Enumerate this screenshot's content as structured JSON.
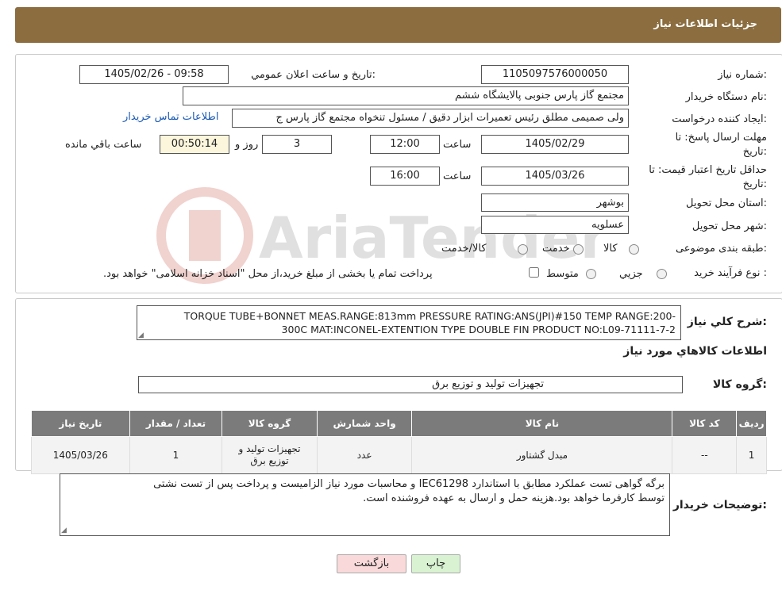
{
  "header": {
    "title": "جزئیات اطلاعات نیاز"
  },
  "form": {
    "need_number": {
      "label": "شماره نیاز:",
      "value": "1105097576000050"
    },
    "announce_datetime": {
      "label": "تاريخ و ساعت اعلان عمومي:",
      "value": "1405/02/26 - 09:58"
    },
    "buyer_org": {
      "label": "نام دستگاه خريدار:",
      "value": "مجتمع گاز پارس جنوبی  پالایشگاه ششم"
    },
    "requester": {
      "label": "ايجاد کننده درخواست:",
      "value": "ولی صمیمی مطلق رئیس تعمیرات ابزار دقیق / مسئول تنخواه مجتمع گاز پارس ج",
      "contact_link": "اطلاعات تماس خريدار"
    },
    "reply_deadline": {
      "label_line1": "مهلت ارسال پاسخ: تا",
      "label_line2": "تاريخ:",
      "date": "1405/02/29",
      "time_label": "ساعت",
      "time": "12:00",
      "days": "3",
      "days_label": "روز و",
      "remaining": "00:50:14",
      "remaining_label": "ساعت باقي مانده"
    },
    "price_validity": {
      "label_line1": "حداقل تاريخ اعتبار قيمت: تا",
      "label_line2": "تاريخ:",
      "date": "1405/03/26",
      "time_label": "ساعت",
      "time": "16:00"
    },
    "province": {
      "label": "استان محل تحويل:",
      "value": "بوشهر"
    },
    "city": {
      "label": "شهر محل تحويل:",
      "value": "عسلویه"
    },
    "category": {
      "label": "طبقه بندی موضوعی:",
      "options": [
        "کالا",
        "خدمت",
        "کالا/خدمت"
      ]
    },
    "purchase_process": {
      "label": "نوع فرآيند خريد :",
      "options": [
        "جزيي",
        "متوسط"
      ],
      "note": "پرداخت تمام يا بخشی از مبلغ خريد،از محل \"اسناد خزانه اسلامی\" خواهد بود."
    }
  },
  "description": {
    "label": "شرح کلي نياز:",
    "line1": "TORQUE TUBE+BONNET MEAS.RANGE:813mm PRESSURE RATING:ANS(JPI)#150 TEMP RANGE:200-",
    "line2": "300C MAT:INCONEL-EXTENTION TYPE DOUBLE FIN PRODUCT NO:L09-71111-7-2"
  },
  "goods_section": {
    "title": "اطلاعات کالاهاي مورد نياز",
    "group_label": "گروه کالا:",
    "group_value": "تجهیزات تولید و توزیع برق"
  },
  "table": {
    "headers": [
      "رديف",
      "کد کالا",
      "نام کالا",
      "واحد شمارش",
      "گروه کالا",
      "تعداد / مقدار",
      "تاريخ نياز"
    ],
    "rows": [
      {
        "row": "1",
        "code": "--",
        "name": "مبدل گشتاور",
        "unit": "عدد",
        "group": "تجهیزات تولید و توزیع برق",
        "qty": "1",
        "date": "1405/03/26"
      }
    ]
  },
  "buyer_notes": {
    "label": "توضيحات خريدار:",
    "line1": "برگه گواهی تست عملکرد مطابق با استاندارد IEC61298 و محاسبات مورد نیاز الزامیست و پرداخت پس از تست نشتی",
    "line2": "توسط کارفرما خواهد بود.هزینه حمل و ارسال به عهده فروشنده است."
  },
  "buttons": {
    "print": "چاپ",
    "back": "بازگشت"
  },
  "watermark_text": "AriaTender.neT",
  "colors": {
    "header_bg": "#8b6d3f",
    "table_header_bg": "#7b7b7b",
    "back_button_bg": "#f9d9d9",
    "print_button_bg": "#d9f3d2",
    "link": "#1c5ab5"
  }
}
